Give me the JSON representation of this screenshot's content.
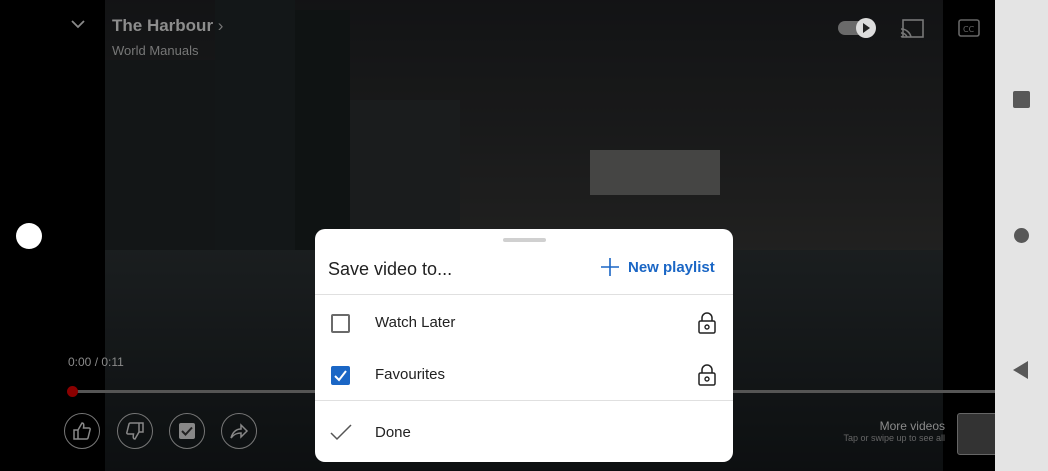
{
  "video": {
    "title": "The Harbour",
    "channel": "World Manuals",
    "time": "0:00 / 0:11",
    "more_videos": "More videos",
    "more_hint": "Tap or swipe up to see all"
  },
  "sheet": {
    "title": "Save video to...",
    "new_playlist": "New playlist",
    "playlists": [
      {
        "label": "Watch Later",
        "checked": false,
        "icon": "lock-icon"
      },
      {
        "label": "Favourites",
        "checked": true,
        "icon": "lock-icon"
      }
    ],
    "done": "Done"
  },
  "colors": {
    "accent": "#1a66c5",
    "navbar": "#e4e4e4"
  }
}
